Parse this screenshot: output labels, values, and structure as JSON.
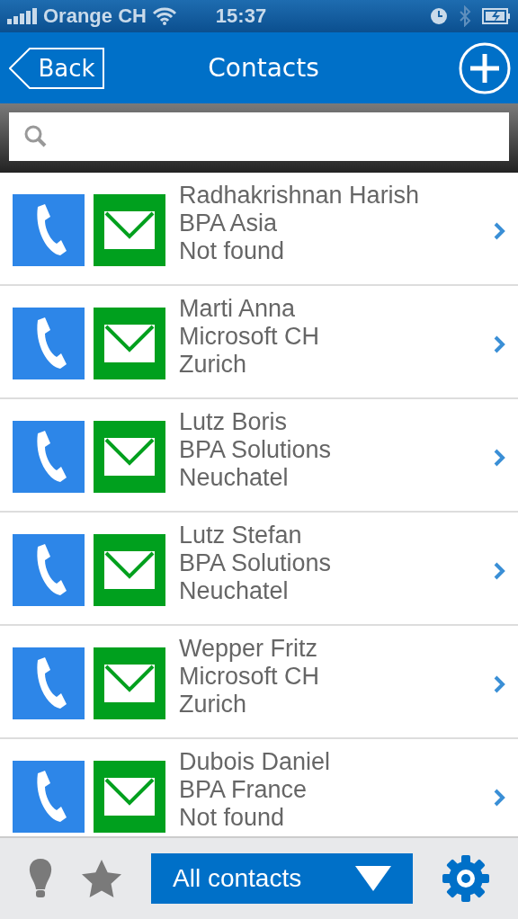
{
  "status_bar": {
    "carrier": "Orange CH",
    "time": "15:37"
  },
  "nav_bar": {
    "back": "Back",
    "title": "Contacts"
  },
  "contacts": [
    {
      "name": "Radhakrishnan Harish",
      "company": "BPA Asia",
      "city": "Not found"
    },
    {
      "name": "Marti Anna",
      "company": "Microsoft CH",
      "city": "Zurich"
    },
    {
      "name": "Lutz Boris",
      "company": "BPA Solutions",
      "city": "Neuchatel"
    },
    {
      "name": "Lutz Stefan",
      "company": "BPA Solutions",
      "city": "Neuchatel"
    },
    {
      "name": "Wepper Fritz",
      "company": "Microsoft CH",
      "city": "Zurich"
    },
    {
      "name": "Dubois Daniel",
      "company": "BPA France",
      "city": "Not found"
    }
  ],
  "toolbar": {
    "filter": "All contacts"
  }
}
